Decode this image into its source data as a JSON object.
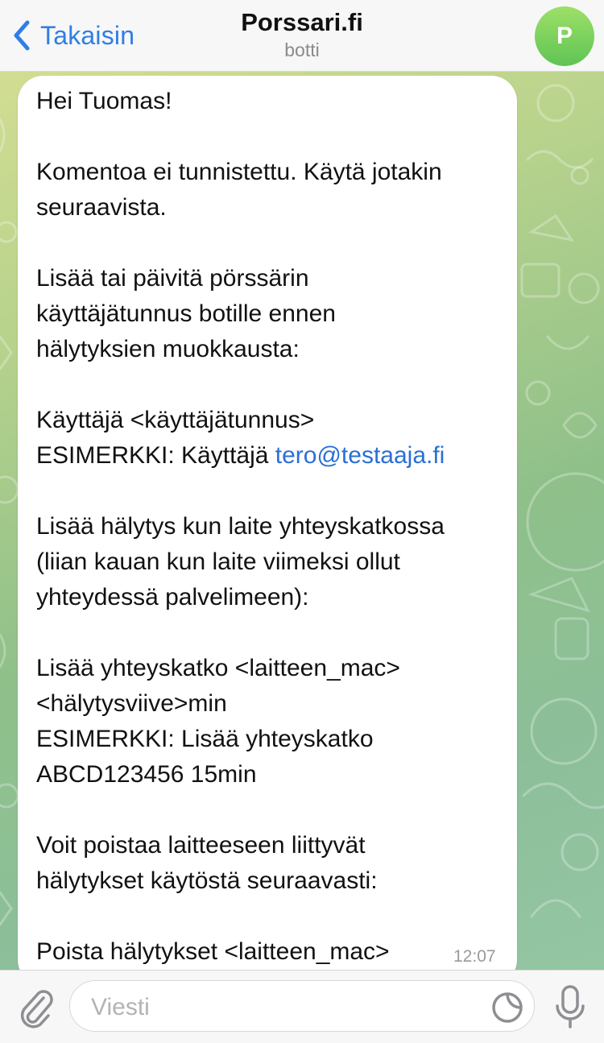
{
  "header": {
    "back_label": "Takaisin",
    "title": "Porssari.fi",
    "subtitle": "botti",
    "avatar_letter": "P"
  },
  "message": {
    "lines": [
      "Hei Tuomas!",
      "",
      "Komentoa ei tunnistettu. Käytä jotakin",
      "seuraavista.",
      "",
      "Lisää tai päivitä pörssärin",
      "käyttäjätunnus botille ennen",
      "hälytyksien muokkausta:",
      "",
      "Käyttäjä <käyttäjätunnus>",
      "ESIMERKKI: Käyttäjä ",
      "",
      "Lisää hälytys kun laite yhteyskatkossa",
      "(liian kauan kun laite viimeksi ollut",
      "yhteydessä palvelimeen):",
      "",
      "Lisää yhteyskatko <laitteen_mac>",
      "<hälytysviive>min",
      "ESIMERKKI: Lisää yhteyskatko",
      "ABCD123456 15min",
      "",
      "Voit poistaa laitteeseen liittyvät",
      "hälytykset käytöstä seuraavasti:",
      "",
      "Poista hälytykset <laitteen_mac>"
    ],
    "link_text": "tero@testaaja.fi",
    "time": "12:07"
  },
  "input_bar": {
    "placeholder": "Viesti",
    "icons": [
      "paperclip-icon",
      "sticker-icon",
      "microphone-icon"
    ]
  },
  "colors": {
    "accent": "#2f7ee6",
    "link": "#2a6fd6",
    "avatar": "#6cc95a"
  }
}
